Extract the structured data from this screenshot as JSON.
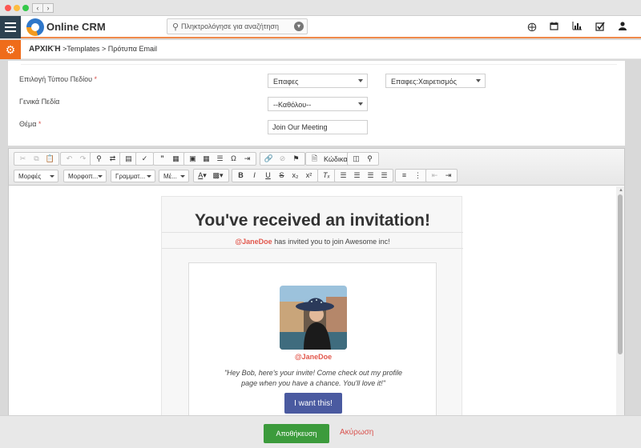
{
  "browser": {
    "back_label": "‹",
    "forward_label": "›"
  },
  "header": {
    "logo_text": "Online CRM",
    "search_placeholder": "Πληκτρολόγησε για αναζήτηση",
    "icons": [
      "plus-circle-icon",
      "calendar-icon",
      "chart-icon",
      "checkbox-icon",
      "user-icon"
    ]
  },
  "breadcrumb": {
    "home": "ΑΡΧΙΚΉ",
    "sep1": ">",
    "item1": "Templates",
    "sep2": ">",
    "item2": "Πρότυπα Email"
  },
  "form": {
    "field_type": {
      "label": "Επιλογή Τύπου Πεδίου",
      "select1_value": "Επαφες",
      "select2_value": "Επαφες:Χαιρετισμός"
    },
    "general_fields": {
      "label": "Γενικά Πεδία",
      "select_value": "--Καθόλου--"
    },
    "subject": {
      "label": "Θέμα",
      "value": "Join Our Meeting"
    },
    "required_mark": "*"
  },
  "editor": {
    "source_label": "Κώδικας",
    "combos": [
      "Μορφές",
      "Μορφοπ...",
      "Γραμματ...",
      "Μέ..."
    ]
  },
  "email": {
    "title": "You've received an invitation!",
    "mention": "@JaneDoe",
    "subtitle_rest": " has invited you to join Awesome inc!",
    "card_name": "@JaneDoe",
    "quote": "\"Hey Bob, here's your invite! Come check out my profile page when you have a chance. You'll love it!\"",
    "button_label": "I want this!"
  },
  "footer": {
    "save_label": "Αποθήκευση",
    "cancel_label": "Ακύρωση"
  },
  "colors": {
    "accent_orange": "#ef6c1a",
    "nav_dark": "#2d4150",
    "save_green": "#3c9b3c",
    "mention_red": "#e2574c",
    "button_blue": "#4a5aa0"
  }
}
